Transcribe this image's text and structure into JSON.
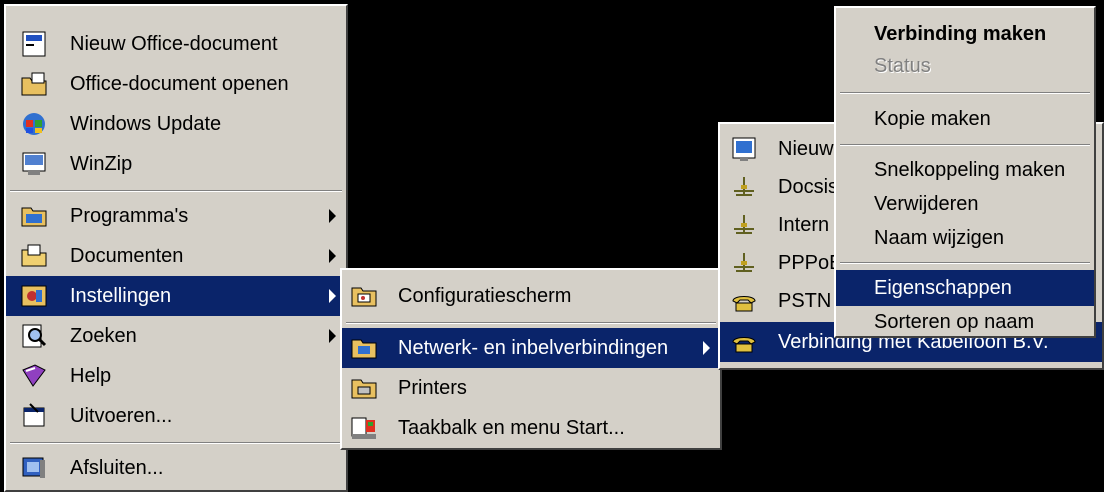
{
  "start_menu": {
    "items": [
      {
        "label": "Nieuw Office-document",
        "icon": "office-new-icon"
      },
      {
        "label": "Office-document openen",
        "icon": "office-open-icon"
      },
      {
        "label": "Windows Update",
        "icon": "windows-update-icon"
      },
      {
        "label": "WinZip",
        "icon": "winzip-icon"
      },
      {
        "label": "Programma's",
        "icon": "programs-folder-icon"
      },
      {
        "label": "Documenten",
        "icon": "documents-folder-icon"
      },
      {
        "label": "Instellingen",
        "icon": "settings-icon"
      },
      {
        "label": "Zoeken",
        "icon": "search-icon"
      },
      {
        "label": "Help",
        "icon": "help-book-icon"
      },
      {
        "label": "Uitvoeren...",
        "icon": "run-icon"
      },
      {
        "label": "Afsluiten...",
        "icon": "shutdown-icon"
      }
    ]
  },
  "settings_menu": {
    "items": [
      {
        "label": "Configuratiescherm",
        "icon": "control-panel-icon"
      },
      {
        "label": "Netwerk- en inbelverbindingen",
        "icon": "network-connections-icon"
      },
      {
        "label": "Printers",
        "icon": "printers-icon"
      },
      {
        "label": "Taakbalk en menu Start...",
        "icon": "taskbar-icon"
      }
    ]
  },
  "network_menu": {
    "items": [
      {
        "label": "Nieuw",
        "icon": "new-connection-icon"
      },
      {
        "label": "Docsis",
        "icon": "lan-connection-icon"
      },
      {
        "label": "Intern",
        "icon": "lan-connection-icon"
      },
      {
        "label": "PPPoE",
        "icon": "lan-connection-icon"
      },
      {
        "label": "PSTN I",
        "icon": "dialup-phone-icon"
      },
      {
        "label": "Verbinding met Kabelfoon B.V.",
        "icon": "dialup-phone-icon"
      }
    ]
  },
  "context_menu": {
    "items": [
      {
        "label": "Verbinding maken"
      },
      {
        "label": "Status"
      },
      {
        "label": "Kopie maken"
      },
      {
        "label": "Snelkoppeling maken"
      },
      {
        "label": "Verwijderen"
      },
      {
        "label": "Naam wijzigen"
      },
      {
        "label": "Eigenschappen"
      },
      {
        "label": "Sorteren op naam"
      }
    ]
  },
  "colors": {
    "menu_bg": "#d4d0c8",
    "highlight": "#0a246a",
    "highlight_text": "#ffffff",
    "desktop": "#000000",
    "disabled_text": "#808080"
  }
}
